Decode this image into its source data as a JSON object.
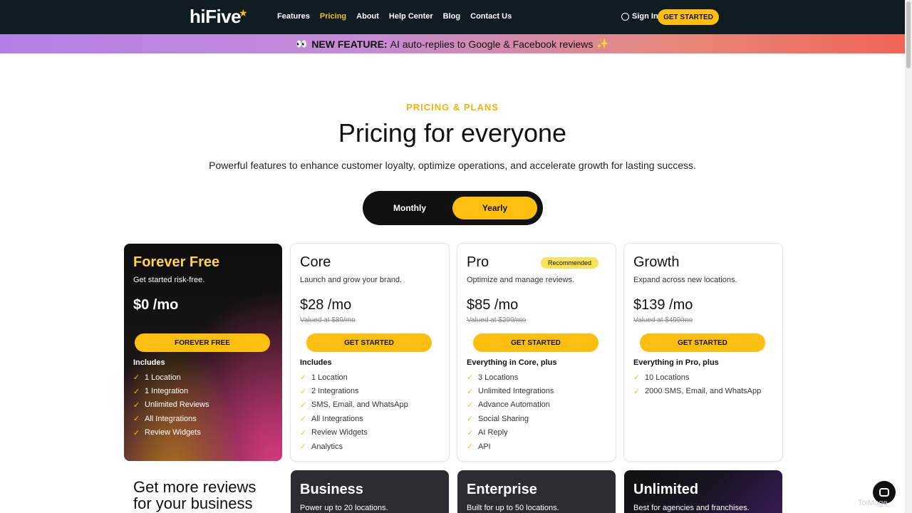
{
  "header": {
    "logo": "hiFive",
    "nav": [
      "Features",
      "Pricing",
      "About",
      "Help Center",
      "Blog",
      "Contact Us"
    ],
    "signin": "Sign In",
    "cta": "GET STARTED"
  },
  "banner": {
    "label": "NEW FEATURE:",
    "text": "AI auto-replies to Google & Facebook reviews"
  },
  "hero": {
    "eyebrow": "PRICING & PLANS",
    "title": "Pricing for everyone",
    "subtitle": "Powerful features to enhance customer loyalty, optimize operations, and accelerate growth for lasting success."
  },
  "toggle": {
    "monthly": "Monthly",
    "yearly": "Yearly",
    "selected": "Yearly"
  },
  "plans": [
    {
      "name": "Forever Free",
      "desc": "Get started risk-free.",
      "price": "$0 /mo",
      "valued": "",
      "cta": "FOREVER FREE",
      "includes": "Includes",
      "features": [
        "1 Location",
        "1 Integration",
        "Unlimited Reviews",
        "All Integrations",
        "Review Widgets"
      ]
    },
    {
      "name": "Core",
      "desc": "Launch and grow your brand.",
      "price": "$28 /mo",
      "valued": "Valued at $89/mo",
      "cta": "GET STARTED",
      "includes": "Includes",
      "features": [
        "1 Location",
        "2 Integrations",
        "SMS, Email, and WhatsApp",
        "All Integrations",
        "Review Widgets",
        "Analytics"
      ]
    },
    {
      "name": "Pro",
      "badge": "Recommended",
      "desc": "Optimize and manage reviews.",
      "price": "$85 /mo",
      "valued": "Valued at $299/mo",
      "cta": "GET STARTED",
      "includes": "Everything in Core, plus",
      "features": [
        "3 Locations",
        "Unlimited Integrations",
        "Advance Automation",
        "Social Sharing",
        "AI Reply",
        "API"
      ]
    },
    {
      "name": "Growth",
      "desc": "Expand across new locations.",
      "price": "$139 /mo",
      "valued": "Valued at $499/mo",
      "cta": "GET STARTED",
      "includes": "Everything in Pro, plus",
      "features": [
        "10 Locations",
        "2000 SMS, Email, and WhatsApp"
      ]
    }
  ],
  "more": {
    "line1": "Get more reviews",
    "line2": "for your business"
  },
  "bigplans": [
    {
      "name": "Business",
      "desc": "Power up to 20 locations."
    },
    {
      "name": "Enterprise",
      "desc": "Built for up to 50 locations."
    },
    {
      "name": "Unlimited",
      "desc": "Best for agencies and franchises."
    }
  ],
  "watermark": "ToiMage",
  "colors": {
    "accent": "#fcbf0f",
    "dark": "#0f1c22"
  }
}
